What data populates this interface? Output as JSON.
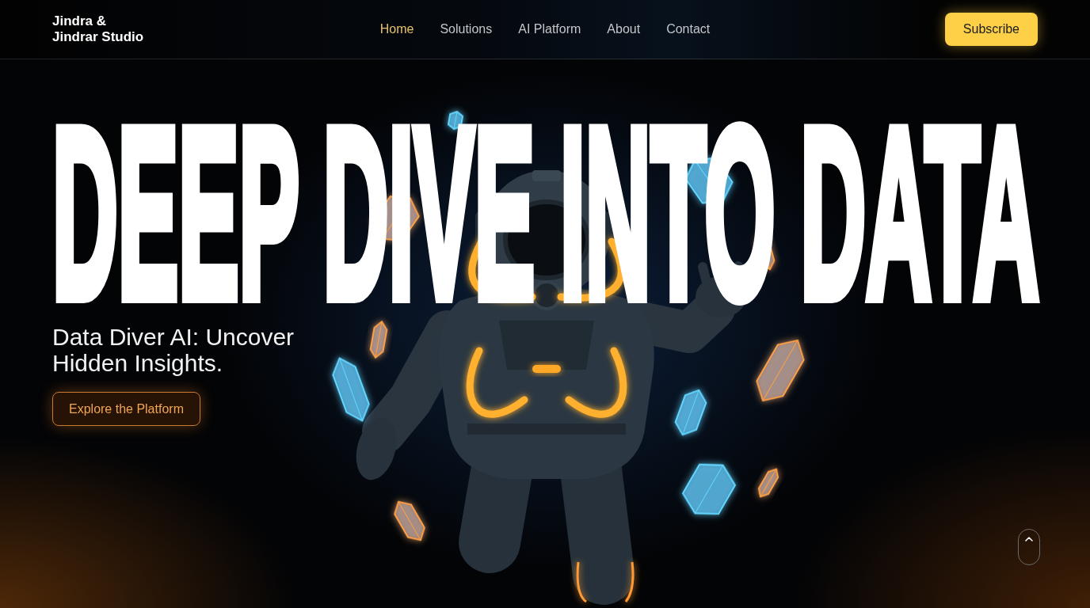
{
  "header": {
    "logo": "Jindra &\nJindrar Studio",
    "nav": [
      {
        "label": "Home",
        "selected": true
      },
      {
        "label": "Solutions",
        "selected": false
      },
      {
        "label": "AI Platform",
        "selected": false
      },
      {
        "label": "About",
        "selected": false
      },
      {
        "label": "Contact",
        "selected": false
      }
    ],
    "subscribe_button": "Subscribe"
  },
  "hero": {
    "headline": "DEEP DIVE INTO DATA",
    "subtitle": "Data Diver AI: Uncover Hidden Insights.",
    "cta_button": "Explore the Platform"
  }
}
